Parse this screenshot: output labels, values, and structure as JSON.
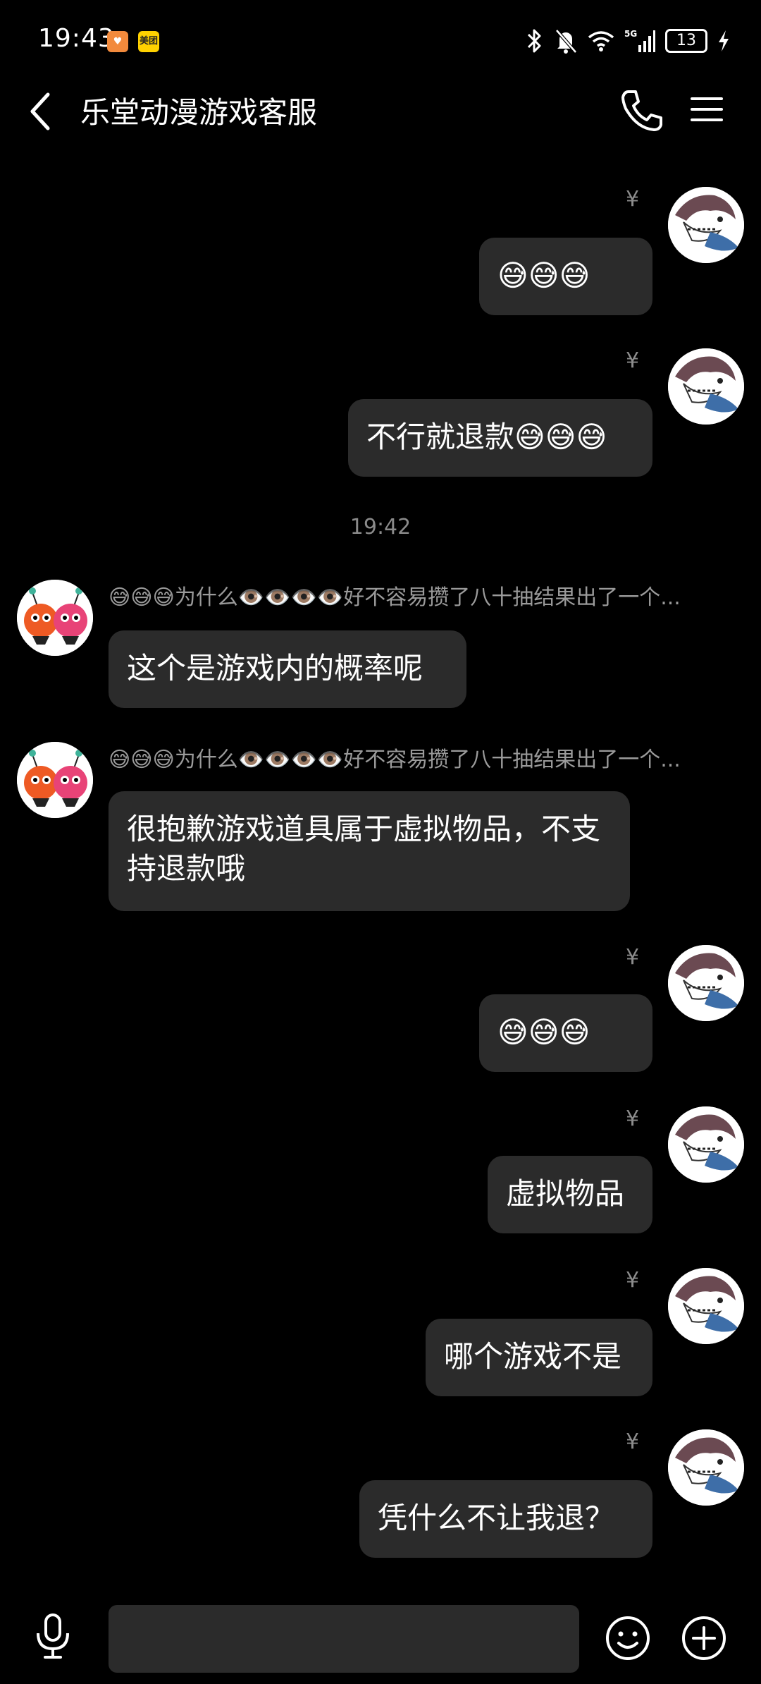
{
  "status_bar": {
    "time": "19:43",
    "app_icon_1": "♥",
    "app_icon_2": "美团",
    "network": "5G",
    "battery": "13"
  },
  "header": {
    "title": "乐堂动漫游戏客服"
  },
  "labels": {
    "yen": "¥",
    "timestamp": "19:42"
  },
  "messages": [
    {
      "side": "sent",
      "text": "😅😅😅"
    },
    {
      "side": "sent",
      "text": "不行就退款😅😅😅"
    },
    {
      "side": "recv",
      "sender": "😅😅😅为什么👁️👁️👁️👁️好不容易攒了八十抽结果出了一个...",
      "text": "这个是游戏内的概率呢"
    },
    {
      "side": "recv",
      "sender": "😅😅😅为什么👁️👁️👁️👁️好不容易攒了八十抽结果出了一个...",
      "text": "很抱歉游戏道具属于虚拟物品，不支持退款哦"
    },
    {
      "side": "sent",
      "text": "😅😅😅"
    },
    {
      "side": "sent",
      "text": "虚拟物品"
    },
    {
      "side": "sent",
      "text": "哪个游戏不是"
    },
    {
      "side": "sent",
      "text": "凭什么不让我退？"
    }
  ],
  "input": {
    "placeholder": "",
    "value": ""
  },
  "icons": {
    "back": "chevron-left-icon",
    "phone": "phone-icon",
    "menu": "hamburger-menu-icon",
    "voice": "microphone-icon",
    "emoji": "smiley-icon",
    "plus": "plus-circle-icon"
  }
}
